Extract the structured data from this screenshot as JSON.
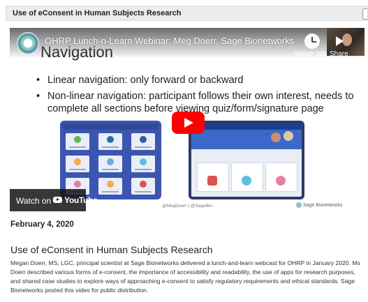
{
  "window": {
    "title": "Use of eConsent in Human Subjects Research"
  },
  "video": {
    "title": "OHRP Lunch-n-Learn Webinar: Meg Doerr, Sage Bionetworks",
    "watch_later_label": "Watch later",
    "share_label": "Share",
    "watch_on_label": "Watch on",
    "youtube_label": "YouTube",
    "slide": {
      "heading": "Navigation",
      "bullets": [
        "Linear navigation: only forward or backward",
        "Non-linear navigation: participant follows their own interest, needs to complete all sections before viewing quiz/form/signature page"
      ],
      "credit": "@MegDoerr | @SageBio",
      "logo_text": "Sage Bionetworks"
    }
  },
  "post": {
    "date": "February 4, 2020",
    "title": "Use of eConsent in Human Subjects Research",
    "body": "Megan Doerr, MS, LGC, principal scientist at Sage Bionetworks delivered a lunch-and-learn webcast for OHRP in January 2020. Ms Doerr described various forms of e-consent, the importance of accessibility and readability, the use of apps for research purposes, and shared case studies to explore ways of approaching e-consent to satisfy regulatory requirements and ethical standards. Sage Bionetworks posted this video for public distribution."
  },
  "colors": {
    "youtube_red": "#ff0000",
    "tablet_blue": "#3b56b0",
    "banner_blue": "#3a69c9"
  }
}
